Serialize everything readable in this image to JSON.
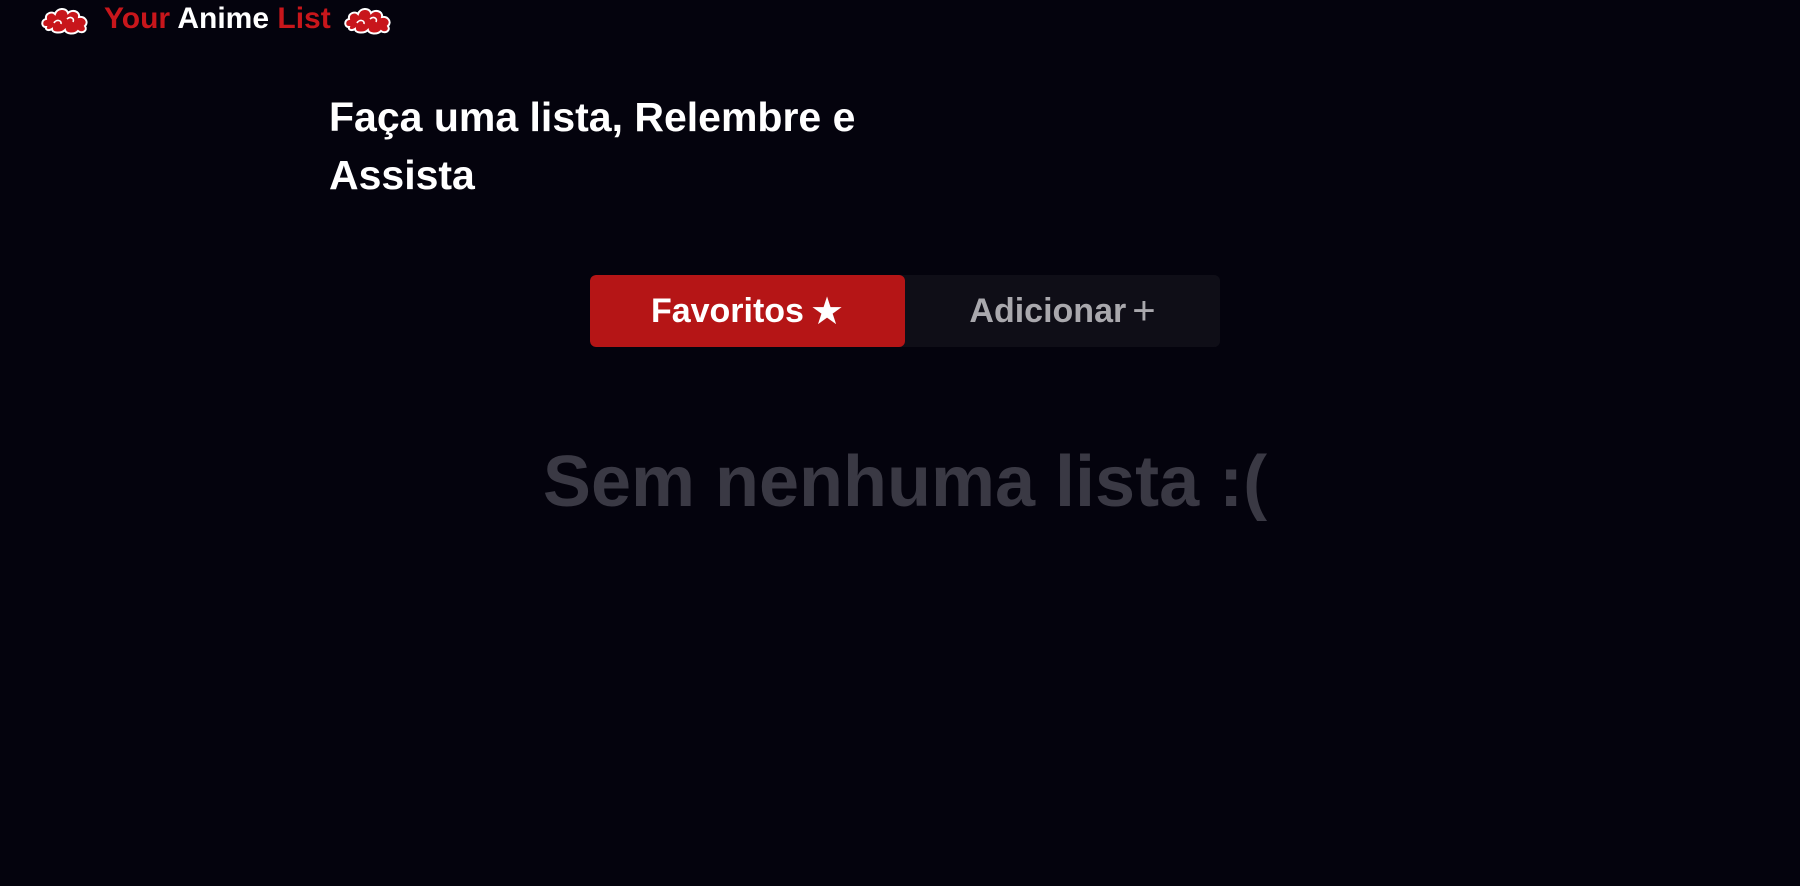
{
  "header": {
    "logo_word_1": "Your",
    "logo_word_2": "Anime",
    "logo_word_3": "List",
    "left_icon": "akatsuki-cloud-icon",
    "right_icon": "akatsuki-cloud-icon"
  },
  "hero": {
    "headline_line_1": "Faça uma lista, Relembre e",
    "headline_line_2": "Assista"
  },
  "tabs": [
    {
      "label": "Favoritos",
      "icon": "★",
      "icon_name": "star-icon",
      "active": true
    },
    {
      "label": "Adicionar",
      "icon": "+",
      "icon_name": "plus-icon",
      "active": false
    }
  ],
  "main": {
    "empty_message": "Sem nenhuma lista :("
  },
  "colors": {
    "background": "#04030d",
    "accent_red": "#b51516",
    "logo_red": "#c8161b",
    "inactive_tab_bg": "#0f0e17",
    "inactive_tab_text": "#a9a8ad",
    "empty_text": "#3a3944"
  }
}
